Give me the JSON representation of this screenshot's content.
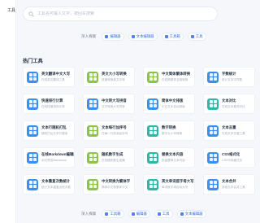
{
  "brand": "工具",
  "search": {
    "placeholder": "工具名可输入文字，按回车搜索"
  },
  "deep_search": {
    "label": "深入探索",
    "chips_top": [
      "编辑器",
      "文本编辑器",
      "工具箱",
      "工具"
    ],
    "chips_bottom": [
      "工具箱",
      "编辑器",
      "工具",
      "文本编辑器"
    ]
  },
  "section_title": "热门工具",
  "colors": {
    "accent": "#2f6fe4",
    "blue": "#3b8ff0",
    "green": "#8cc44a",
    "teal": "#2cb7a8"
  },
  "tools": [
    {
      "name": "英文翻译中文大写",
      "desc": "在线英文翻译工具",
      "color": "#3b8ff0"
    },
    {
      "name": "英文大小写转换",
      "desc": "快速转换英文字母",
      "color": "#8cc44a"
    },
    {
      "name": "中文简体繁体转换",
      "desc": "在线简繁体互相转换",
      "color": "#8cc44a"
    },
    {
      "name": "字数统计",
      "desc": "统计文本字符数",
      "color": "#3b8ff0"
    },
    {
      "name": "快速排行计算",
      "desc": "在线快速排序计算",
      "color": "#3b8ff0"
    },
    {
      "name": "中文转大写拼音",
      "desc": "汉字转换大写拼音",
      "color": "#3b8ff0"
    },
    {
      "name": "简体中文排版",
      "desc": "中文文本自动排版",
      "color": "#3b8ff0"
    },
    {
      "name": "文本对比",
      "desc": "在线文本差异对比",
      "color": "#2cb7a8"
    },
    {
      "name": "文本行随机打乱",
      "desc": "随机打乱文本行顺序",
      "color": "#3b8ff0"
    },
    {
      "name": "文本每行加序号",
      "desc": "在每一行前添加序号",
      "color": "#8cc44a"
    },
    {
      "name": "数字转换",
      "desc": "数字大小写转换",
      "color": "#2cb7a8"
    },
    {
      "name": "文本去重",
      "desc": "在线文本去重工具",
      "color": "#3b8ff0"
    },
    {
      "name": "在线Markdown编辑器",
      "desc": "实时预览Markdown",
      "color": "#3b8ff0"
    },
    {
      "name": "随机数字生成",
      "desc": "在线随机数生成器",
      "color": "#8cc44a"
    },
    {
      "name": "替换文本内容",
      "desc": "批量替换文本内容",
      "color": "#2cb7a8"
    },
    {
      "name": "CSS格式化",
      "desc": "CSS代码格式化",
      "color": "#3b8ff0"
    },
    {
      "name": "文本重复次数统计",
      "desc": "统计文本重复出现次数",
      "color": "#3b8ff0"
    },
    {
      "name": "中文转换为繁体字",
      "desc": "简体中文转繁体中文",
      "color": "#8cc44a"
    },
    {
      "name": "英文单词首字母大写",
      "desc": "单词首字母自动大写",
      "color": "#2cb7a8"
    },
    {
      "name": "文本合并",
      "desc": "多段文本合并工具",
      "color": "#3b8ff0"
    }
  ]
}
